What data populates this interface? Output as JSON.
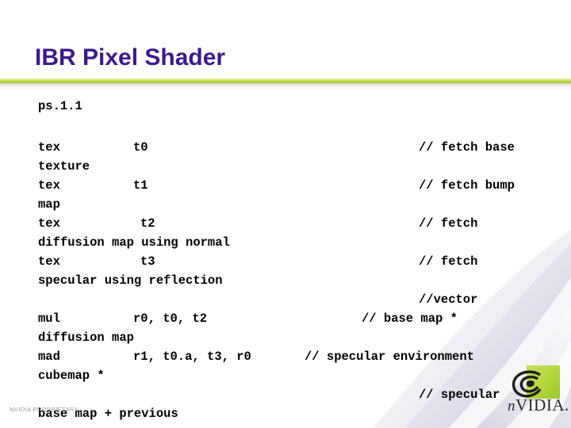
{
  "slide": {
    "title": "IBR Pixel Shader",
    "accent_green": "#b5d93f",
    "title_color": "#3b1a8c",
    "background": "#ffffff"
  },
  "code": {
    "version": "ps.1.1",
    "lines": [
      {
        "op": "tex",
        "args": "t0",
        "comment": "// fetch base",
        "tail": "texture"
      },
      {
        "op": "tex",
        "args": "t1",
        "comment": "// fetch bump",
        "tail": "map"
      },
      {
        "op": "tex",
        "args": "t2",
        "comment": "// fetch",
        "tail": "diffusion map using normal"
      },
      {
        "op": "tex",
        "args": "t3",
        "comment": "// fetch",
        "tail": "specular using reflection",
        "comment2": "//vector"
      },
      {
        "op": "mul",
        "args": "r0, t0, t2",
        "comment": "// base map *",
        "tail": "diffusion map"
      },
      {
        "op": "mad",
        "args": "r1, t0.a, t3, r0",
        "comment": "// specular environment",
        "tail": "cubemap *",
        "comment2": "// specular"
      },
      {
        "op": "",
        "args": "",
        "comment": "",
        "tail": "base map + previous"
      }
    ]
  },
  "footer": {
    "proprietary": "NVIDIA PROPRIETARY"
  },
  "logo": {
    "wordmark_n": "n",
    "wordmark_rest": "VIDIA.",
    "eye_icon": "nvidia-eye-icon"
  }
}
